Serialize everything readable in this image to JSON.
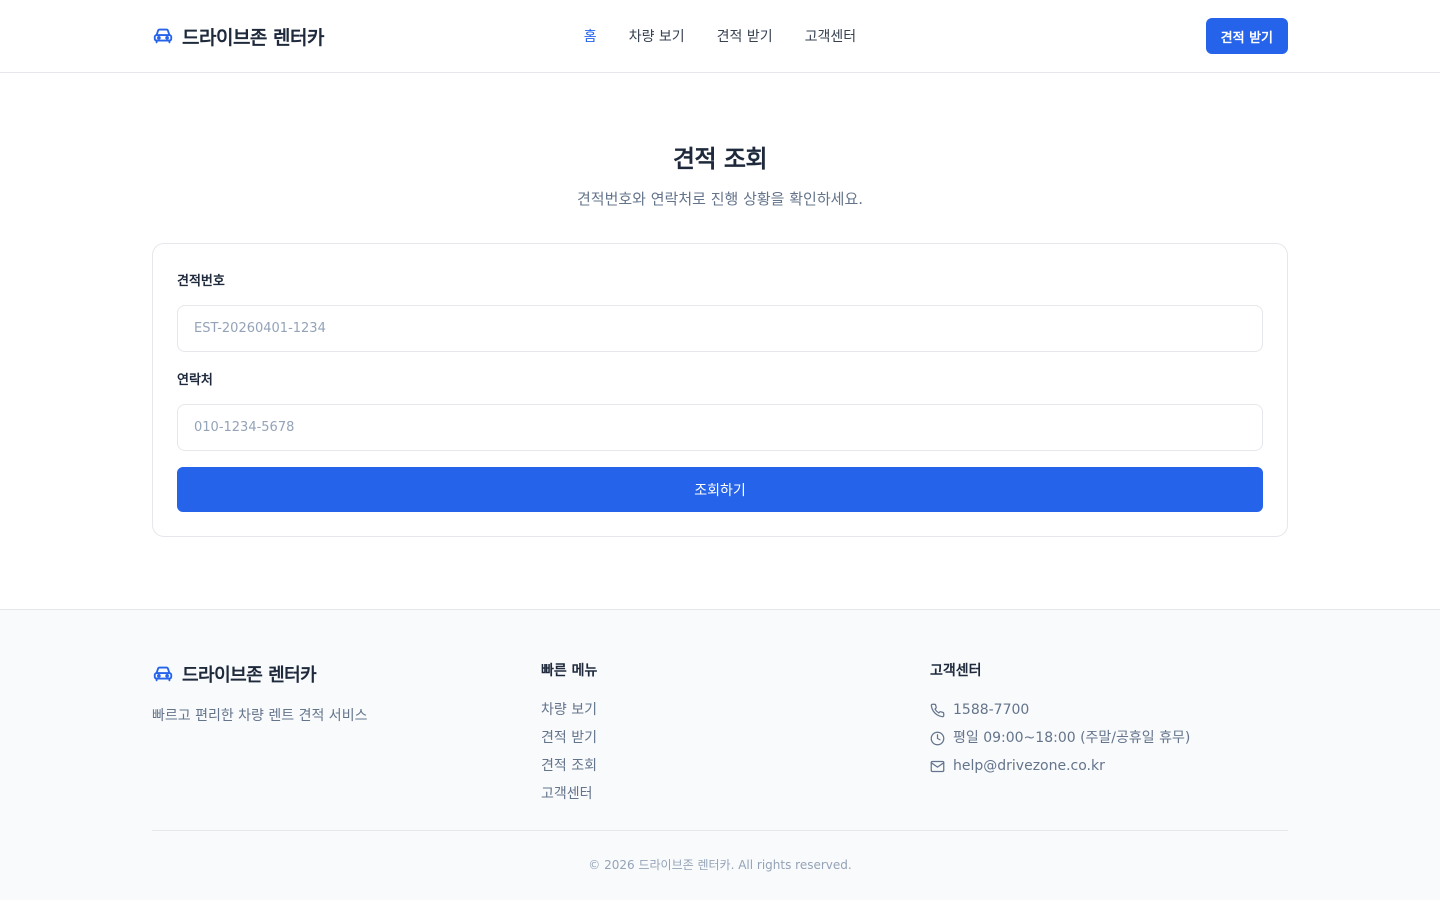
{
  "brand": {
    "name": "드라이브존 렌터카"
  },
  "nav": {
    "items": [
      {
        "label": "홈",
        "active": true
      },
      {
        "label": "차량 보기"
      },
      {
        "label": "견적 받기"
      },
      {
        "label": "고객센터"
      }
    ],
    "cta_label": "견적 받기"
  },
  "main": {
    "title": "견적 조회",
    "subtitle": "견적번호와 연락처로 진행 상황을 확인하세요.",
    "form": {
      "estimate_label": "견적번호",
      "estimate_placeholder": "EST-20260401-1234",
      "contact_label": "연락처",
      "contact_placeholder": "010-1234-5678",
      "submit_label": "조회하기"
    }
  },
  "footer": {
    "brand_name": "드라이브존 렌터카",
    "description": "빠르고 편리한 차량 렌트 견적 서비스",
    "quick_menu": {
      "heading": "빠른 메뉴",
      "items": [
        "차량 보기",
        "견적 받기",
        "견적 조회",
        "고객센터"
      ]
    },
    "support": {
      "heading": "고객센터",
      "phone": "1588-7700",
      "hours": "평일 09:00~18:00 (주말/공휴일 휴무)",
      "email": "help@drivezone.co.kr"
    },
    "copyright": "© 2026 드라이브존 렌터카. All rights reserved."
  },
  "colors": {
    "accent": "#2563eb",
    "text": "#1e293b",
    "muted": "#64748b"
  }
}
